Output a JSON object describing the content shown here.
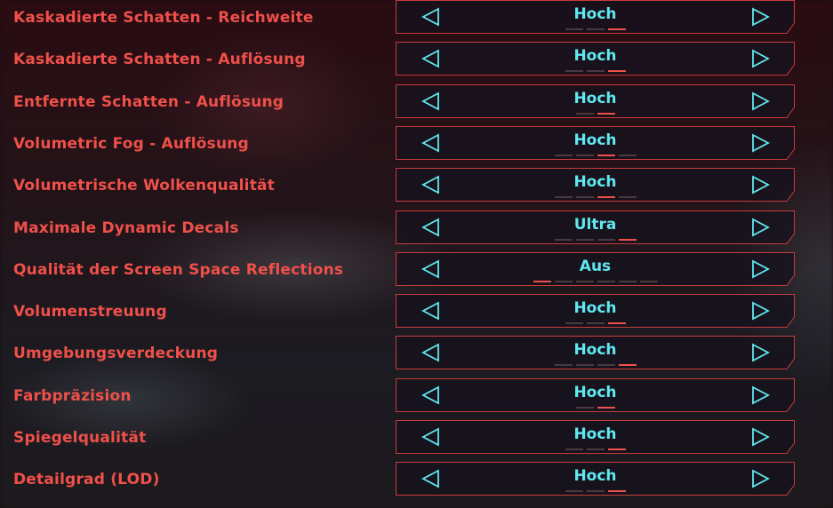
{
  "colors": {
    "label": "#f0504a",
    "value": "#5fe8f0",
    "frame": "#c73b3b",
    "active_dot": "#f0504a",
    "inactive_dot": "#4a3a3f"
  },
  "settings": [
    {
      "label": "Kaskadierte Schatten - Reichweite",
      "value": "Hoch",
      "levels": 3,
      "active": 2
    },
    {
      "label": "Kaskadierte Schatten - Auflösung",
      "value": "Hoch",
      "levels": 3,
      "active": 2
    },
    {
      "label": "Entfernte Schatten - Auflösung",
      "value": "Hoch",
      "levels": 2,
      "active": 1
    },
    {
      "label": "Volumetric Fog - Auflösung",
      "value": "Hoch",
      "levels": 4,
      "active": 2
    },
    {
      "label": "Volumetrische Wolkenqualität",
      "value": "Hoch",
      "levels": 4,
      "active": 2
    },
    {
      "label": "Maximale Dynamic Decals",
      "value": "Ultra",
      "levels": 4,
      "active": 3
    },
    {
      "label": "Qualität der Screen Space Reflections",
      "value": "Aus",
      "levels": 6,
      "active": 0
    },
    {
      "label": "Volumenstreuung",
      "value": "Hoch",
      "levels": 3,
      "active": 2
    },
    {
      "label": "Umgebungsverdeckung",
      "value": "Hoch",
      "levels": 4,
      "active": 3
    },
    {
      "label": "Farbpräzision",
      "value": "Hoch",
      "levels": 2,
      "active": 1
    },
    {
      "label": "Spiegelqualität",
      "value": "Hoch",
      "levels": 3,
      "active": 2
    },
    {
      "label": "Detailgrad (LOD)",
      "value": "Hoch",
      "levels": 3,
      "active": 2
    }
  ]
}
